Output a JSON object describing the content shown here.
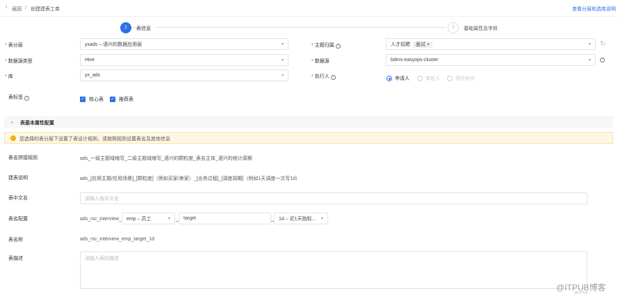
{
  "header": {
    "back": "返回",
    "sep": "/",
    "title": "创建建表工单",
    "help_link": "查看分层和选库说明"
  },
  "steps": [
    {
      "num": "1",
      "label": "表信息"
    },
    {
      "num": "2",
      "label": "基础属性及字段"
    }
  ],
  "form": {
    "layer": {
      "label": "表分层",
      "value": "yxads – 语兴的数据应用层"
    },
    "ds_type": {
      "label": "数据源类型",
      "value": "Hive"
    },
    "db": {
      "label": "库",
      "value": "yx_ads"
    },
    "topic": {
      "label": "主题归属",
      "tags": [
        "人才招聘",
        "面试"
      ]
    },
    "datasource": {
      "label": "数据源",
      "value": "bdms-easyops-cluster"
    },
    "executor": {
      "label": "执行人",
      "options": [
        "申请人",
        "审批人",
        "项目账号"
      ]
    },
    "table_tags": {
      "label": "表标签",
      "options": [
        "核心表",
        "推荐表"
      ]
    }
  },
  "section": {
    "title": "表基本属性配置",
    "warning": "您选择的表分层下设置了表设计规则，请按照规则设置表名及其他信息",
    "rule_label": "表名拼接规则",
    "rule": "ads_一级主题域缩写_二级主题域缩写_语兴的颗粒度_表名主体_语兴的统计周期",
    "desc_label": "建表说明",
    "desc": "ads_[应用主题/应用场景]_[颗粒度]（例如买家/卖家）_[业务过程]_[调度周期]（例如1天调度一次写1d）",
    "cn_label": "表中文名",
    "cn_placeholder": "请输入表中文名",
    "cfg_label": "表名配置",
    "cfg_prefix": "ads_rsc_interview_",
    "cfg_sel1": "emp – 员工",
    "cfg_sep": "_",
    "cfg_input": "target",
    "cfg_sel2": "1d – 近1天指标...",
    "name_label": "表名称",
    "name": "ads_rsc_interview_emp_target_1d",
    "desc2_label": "表描述",
    "desc2_placeholder": "请输入表的描述"
  },
  "watermark": {
    "text": "@ITPUB博客",
    "sub": "@ITPUB"
  }
}
